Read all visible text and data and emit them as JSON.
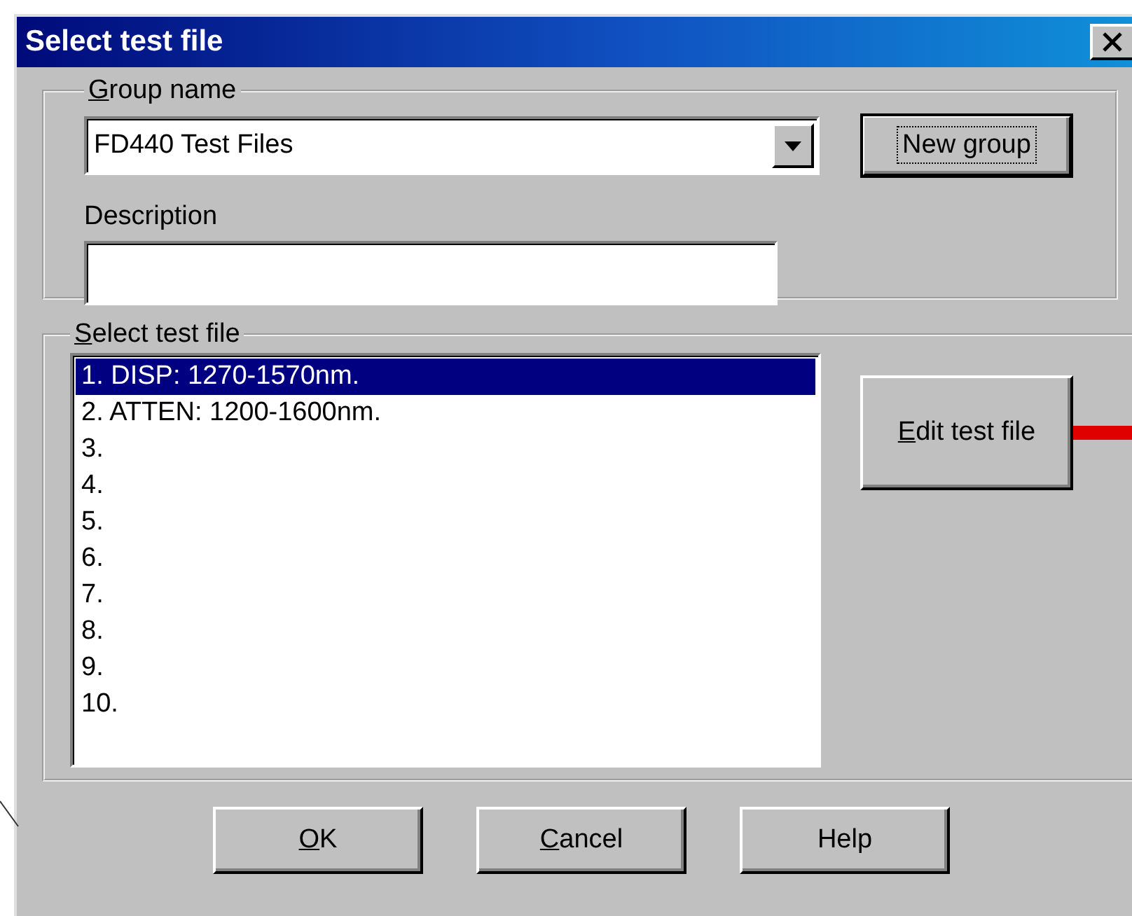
{
  "window": {
    "title": "Select test file"
  },
  "group_box": {
    "label": "Group name",
    "underline_first": true,
    "group_name": {
      "value": "FD440 Test Files"
    },
    "new_group_button": {
      "label": "New group",
      "focused": true,
      "underline_first": false
    },
    "description": {
      "label": "Description"
    }
  },
  "select_box": {
    "label": "Select test file",
    "underline_first": true,
    "files": [
      {
        "label": "1. DISP: 1270-1570nm.",
        "selected": true
      },
      {
        "label": "2. ATTEN: 1200-1600nm.",
        "selected": false
      },
      {
        "label": "3.",
        "selected": false
      },
      {
        "label": "4.",
        "selected": false
      },
      {
        "label": "5.",
        "selected": false
      },
      {
        "label": "6.",
        "selected": false
      },
      {
        "label": "7.",
        "selected": false
      },
      {
        "label": "8.",
        "selected": false
      },
      {
        "label": "9.",
        "selected": false
      },
      {
        "label": "10.",
        "selected": false
      }
    ],
    "edit_button": {
      "label": "Edit test file",
      "underline_first": true,
      "focused": false
    }
  },
  "buttons": [
    {
      "label": "OK",
      "underline_first": true,
      "focused": false
    },
    {
      "label": "Cancel",
      "underline_first": true,
      "focused": false
    },
    {
      "label": "Help",
      "underline_first": false,
      "focused": false
    }
  ]
}
